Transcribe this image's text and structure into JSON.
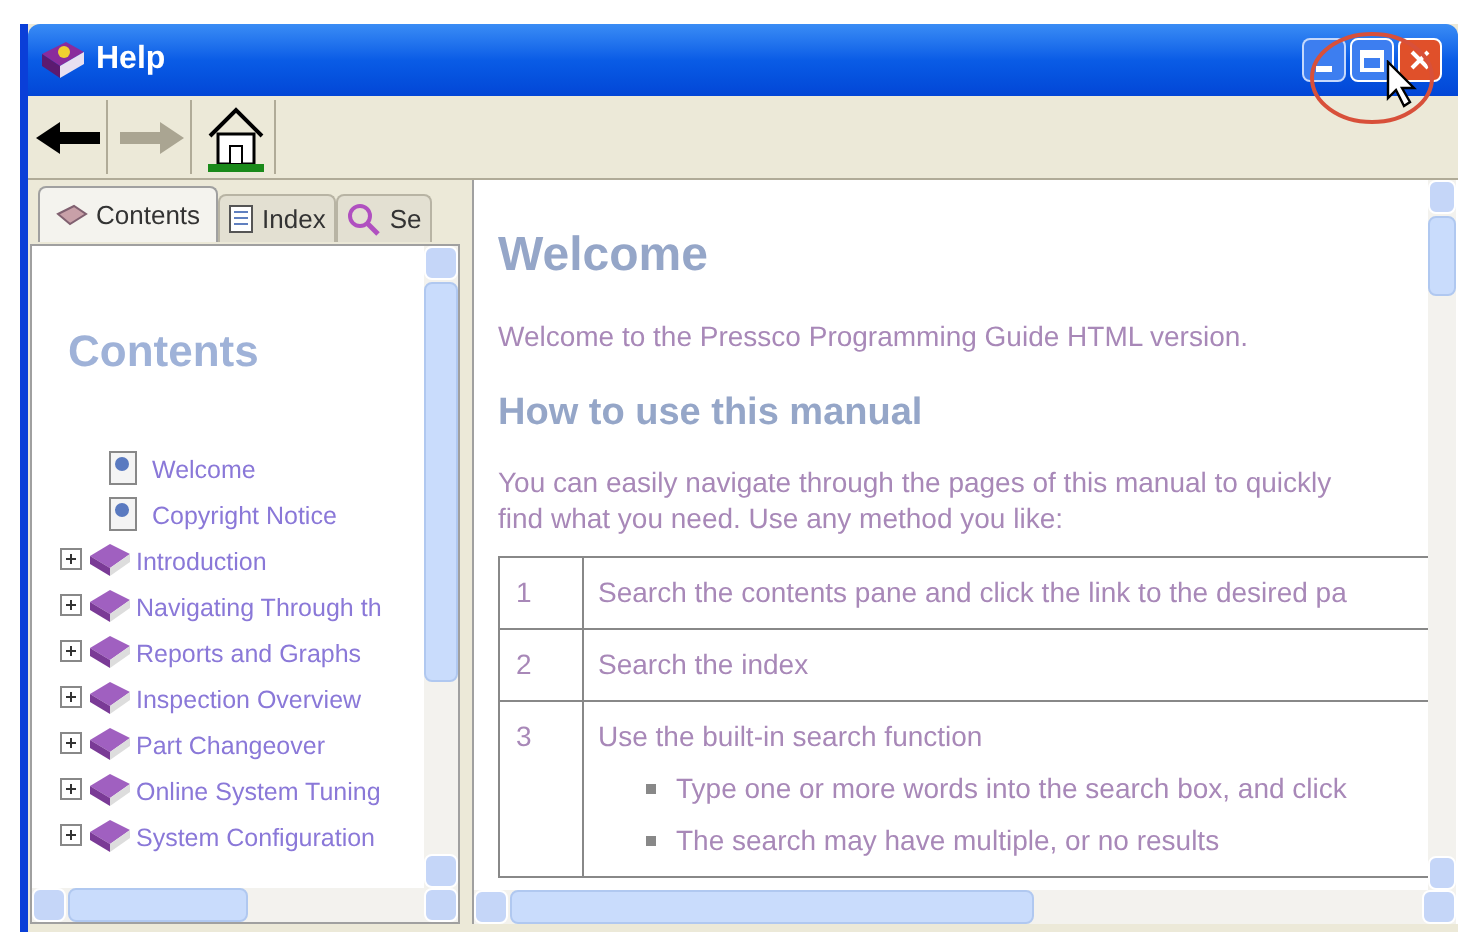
{
  "window": {
    "title": "Help"
  },
  "toolbar": [
    {
      "kind": "back",
      "disabled": false
    },
    {
      "kind": "forward",
      "disabled": true
    },
    {
      "kind": "home",
      "disabled": false
    }
  ],
  "nav_tabs": [
    {
      "kind": "contents",
      "label": "Contents",
      "selected": true
    },
    {
      "kind": "index",
      "label": "Index",
      "selected": false
    },
    {
      "kind": "search",
      "label": "Se",
      "selected": false
    }
  ],
  "contents_pane": {
    "heading": "Contents",
    "items": [
      {
        "kind": "page",
        "label": "Welcome"
      },
      {
        "kind": "page",
        "label": "Copyright Notice"
      },
      {
        "kind": "book",
        "label": "Introduction"
      },
      {
        "kind": "book",
        "label": "Navigating Through th"
      },
      {
        "kind": "book",
        "label": "Reports and Graphs"
      },
      {
        "kind": "book",
        "label": "Inspection Overview"
      },
      {
        "kind": "book",
        "label": "Part Changeover"
      },
      {
        "kind": "book",
        "label": "Online System Tuning"
      },
      {
        "kind": "book",
        "label": "System Configuration"
      }
    ]
  },
  "article": {
    "title": "Welcome",
    "intro": "Welcome to the Pressco Programming Guide HTML version.",
    "subheading": "How to use this manual",
    "paragraph": "You can easily navigate through the pages of this manual to quickly find what you need. Use any method you like:",
    "table_rows": [
      {
        "number": "1",
        "text": "Search the contents pane and click the link to the desired pa"
      },
      {
        "number": "2",
        "text": "Search the index"
      },
      {
        "number": "3",
        "text": "Use the built-in search function",
        "bullets": [
          "Type one or more words into the search box, and click",
          "The search may have multiple, or no results"
        ]
      }
    ]
  }
}
